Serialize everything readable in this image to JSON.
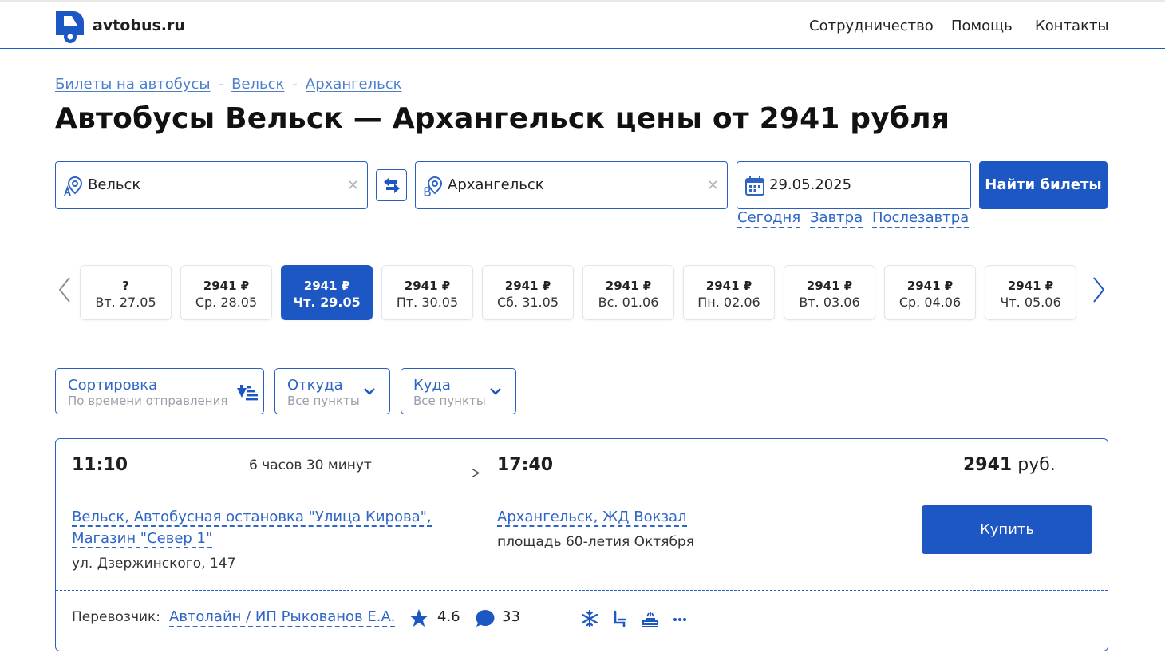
{
  "header": {
    "brand": "avtobus.ru",
    "nav": [
      "Сотрудничество",
      "Помощь",
      "Контакты"
    ]
  },
  "breadcrumbs": [
    "Билеты на автобусы",
    "Вельск",
    "Архангельск"
  ],
  "breadcrumb_separator": "-",
  "page_title": "Автобусы Вельск — Архангельск цены от 2941 рубля",
  "search": {
    "from": "Вельск",
    "to": "Архангельск",
    "date": "29.05.2025",
    "clear_symbol": "✕",
    "submit_label": "Найти билеты",
    "quick_dates": [
      "Сегодня",
      "Завтра",
      "Послезавтра"
    ]
  },
  "dates": [
    {
      "price": "?",
      "day": "Вт. 27.05",
      "active": false
    },
    {
      "price": "2941 ₽",
      "day": "Ср. 28.05",
      "active": false
    },
    {
      "price": "2941 ₽",
      "day": "Чт. 29.05",
      "active": true
    },
    {
      "price": "2941 ₽",
      "day": "Пт. 30.05",
      "active": false
    },
    {
      "price": "2941 ₽",
      "day": "Сб. 31.05",
      "active": false
    },
    {
      "price": "2941 ₽",
      "day": "Вс. 01.06",
      "active": false
    },
    {
      "price": "2941 ₽",
      "day": "Пн. 02.06",
      "active": false
    },
    {
      "price": "2941 ₽",
      "day": "Вт. 03.06",
      "active": false
    },
    {
      "price": "2941 ₽",
      "day": "Ср. 04.06",
      "active": false
    },
    {
      "price": "2941 ₽",
      "day": "Чт. 05.06",
      "active": false
    }
  ],
  "filters": {
    "sort": {
      "label": "Сортировка",
      "value": "По времени отправления"
    },
    "from": {
      "label": "Откуда",
      "value": "Все пункты"
    },
    "to": {
      "label": "Куда",
      "value": "Все пункты"
    }
  },
  "trip": {
    "departure_time": "11:10",
    "duration": "6 часов 30 минут",
    "arrival_time": "17:40",
    "price_value": "2941",
    "price_unit": "руб.",
    "from_stop_line1": "Вельск, Автобусная остановка \"Улица Кирова\",",
    "from_stop_line2": "Магазин \"Север 1\"",
    "from_address": "ул. Дзержинского, 147",
    "to_stop": "Архангельск, ЖД Вокзал",
    "to_address": "площадь 60-летия Октября",
    "buy_label": "Купить",
    "carrier_label": "Перевозчик:",
    "carrier": "Автолайн / ИП Рыкованов Е.А.",
    "rating": "4.6",
    "reviews": "33",
    "amenities": [
      "snowflake-icon",
      "seat-icon",
      "tv-icon",
      "more-icon"
    ]
  },
  "colors": {
    "accent": "#1c57c4",
    "link": "#2f66c6",
    "border": "#2a5fbf"
  }
}
